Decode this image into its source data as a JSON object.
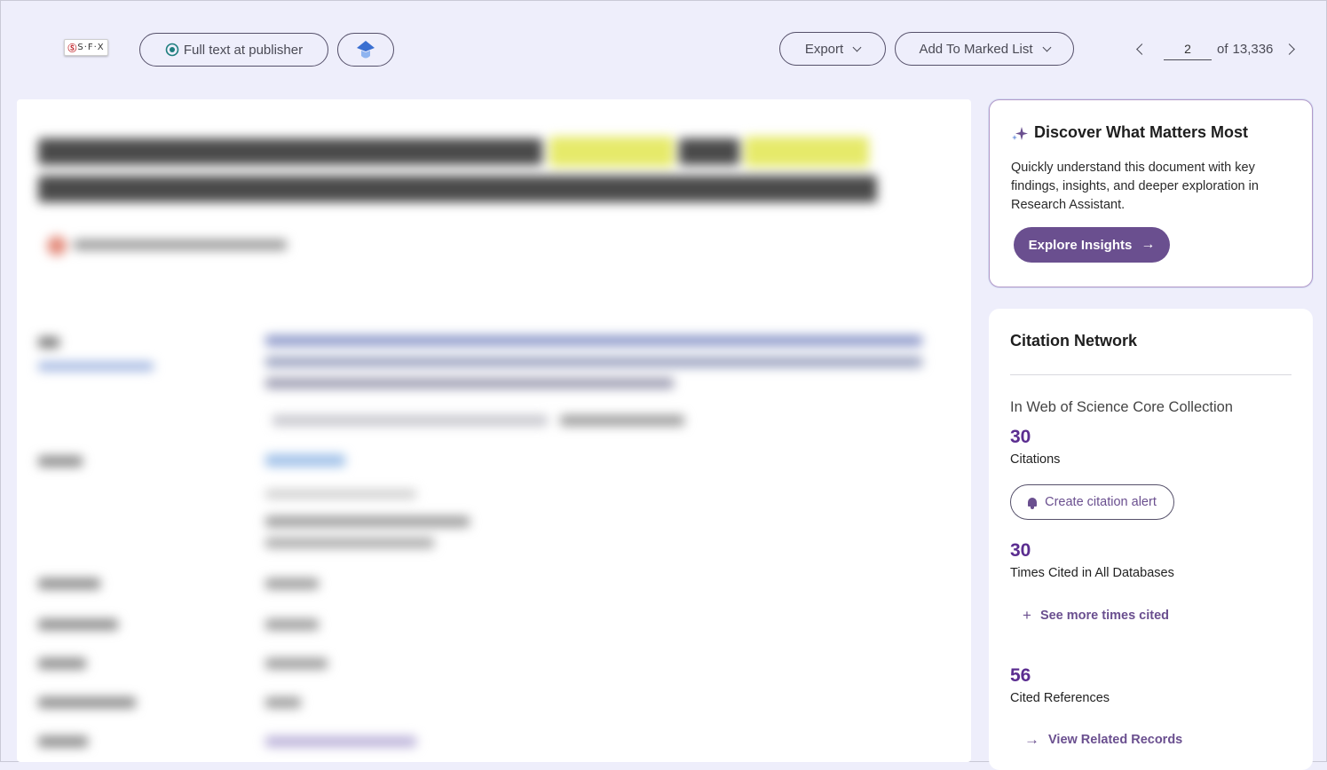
{
  "toolbar": {
    "sfx_logo": "S·F·X",
    "full_text_label": "Full text at publisher",
    "export_label": "Export",
    "marked_list_label": "Add To Marked List",
    "pager": {
      "current_page": "2",
      "of_label": "of",
      "total": "13,336"
    }
  },
  "record": {
    "blurred": true,
    "highlight_color": "#e6ea6a"
  },
  "discover_card": {
    "title": "Discover What Matters Most",
    "description": "Quickly understand this document with key findings, insights, and deeper exploration in Research Assistant.",
    "button_label": "Explore Insights"
  },
  "citation_network": {
    "title": "Citation Network",
    "collection_label": "In Web of Science Core Collection",
    "citations_count": "30",
    "citations_label": "Citations",
    "alert_button_label": "Create citation alert",
    "all_db_count": "30",
    "all_db_label": "Times Cited in All Databases",
    "see_more_label": "See more times cited",
    "cited_refs_count": "56",
    "cited_refs_label": "Cited References",
    "related_label": "View Related Records"
  },
  "colors": {
    "background": "#eeeefb",
    "accent_purple": "#6a4f8f",
    "count_purple": "#5b2d90"
  }
}
